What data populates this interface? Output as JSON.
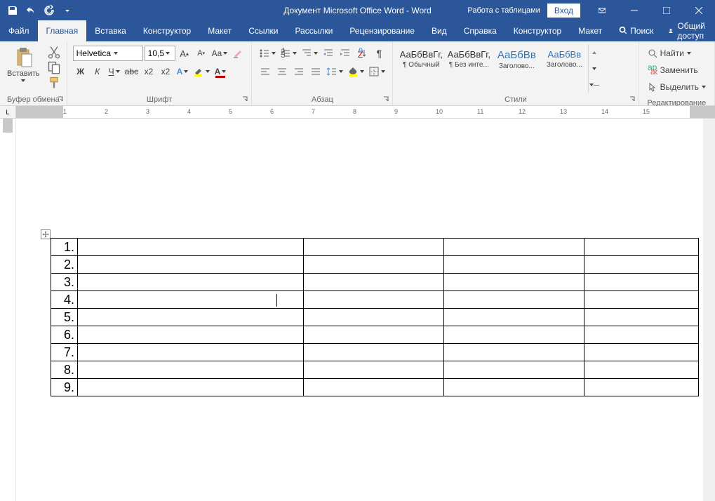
{
  "title": "Документ Microsoft Office Word - Word",
  "tableTools": "Работа с таблицами",
  "login": "Вход",
  "tabs": {
    "file": "Файл",
    "home": "Главная",
    "insert": "Вставка",
    "design": "Конструктор",
    "layout": "Макет",
    "references": "Ссылки",
    "mailings": "Рассылки",
    "review": "Рецензирование",
    "view": "Вид",
    "help": "Справка",
    "tblDesign": "Конструктор",
    "tblLayout": "Макет"
  },
  "tellMe": "Поиск",
  "share": "Общий доступ",
  "clipboard": {
    "paste": "Вставить",
    "label": "Буфер обмена"
  },
  "font": {
    "name": "Helvetica",
    "size": "10,5",
    "label": "Шрифт",
    "bold": "Ж",
    "italic": "К",
    "underline": "Ч"
  },
  "paragraph": {
    "label": "Абзац"
  },
  "styles": {
    "label": "Стили",
    "preview": "АаБбВвГг,",
    "previewHeading": "АаБбВв",
    "items": [
      "¶ Обычный",
      "¶ Без инте...",
      "Заголово...",
      "Заголово..."
    ]
  },
  "editing": {
    "label": "Редактирование",
    "find": "Найти",
    "replace": "Заменить",
    "select": "Выделить"
  },
  "rulerCorner": "L",
  "rulerTicks": [
    "1",
    "2",
    "3",
    "4",
    "5",
    "6",
    "7",
    "8",
    "9",
    "10",
    "11",
    "12",
    "13",
    "14",
    "15"
  ],
  "tableRows": [
    "1.",
    "2.",
    "3.",
    "4.",
    "5.",
    "6.",
    "7.",
    "8.",
    "9."
  ]
}
